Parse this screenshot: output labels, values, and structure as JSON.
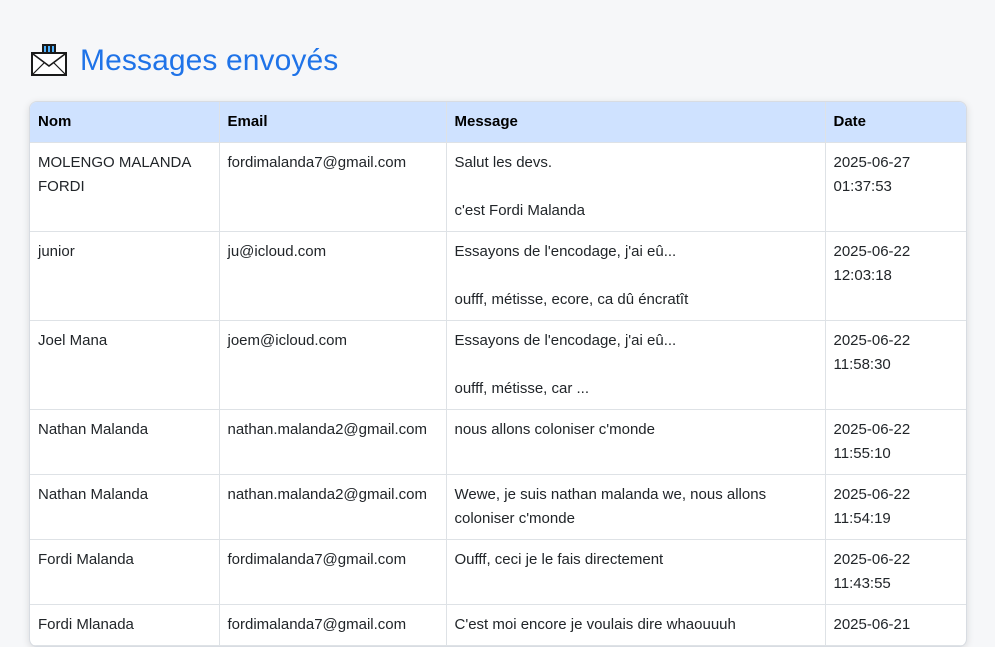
{
  "header": {
    "title": "Messages envoyés",
    "icon": "outbox-tray-icon"
  },
  "table": {
    "columns": [
      "Nom",
      "Email",
      "Message",
      "Date"
    ],
    "rows": [
      {
        "nom": "MOLENGO MALANDA FORDI",
        "email": "fordimalanda7@gmail.com",
        "message": [
          "Salut les devs.",
          "",
          "c'est Fordi Malanda"
        ],
        "date": "2025-06-27 01:37:53"
      },
      {
        "nom": "junior",
        "email": "ju@icloud.com",
        "message": [
          "Essayons de l'encodage, j'ai eû...",
          "",
          "oufff, métisse, ecore, ca dû éncratît"
        ],
        "date": "2025-06-22 12:03:18"
      },
      {
        "nom": "Joel Mana",
        "email": "joem@icloud.com",
        "message": [
          "Essayons de l'encodage, j'ai eû...",
          "",
          "oufff, métisse, car ..."
        ],
        "date": "2025-06-22 11:58:30"
      },
      {
        "nom": "Nathan Malanda",
        "email": "nathan.malanda2@gmail.com",
        "message": [
          "nous allons coloniser c'monde"
        ],
        "date": "2025-06-22 11:55:10"
      },
      {
        "nom": "Nathan Malanda",
        "email": "nathan.malanda2@gmail.com",
        "message": [
          "Wewe, je suis nathan malanda we, nous allons coloniser c'monde"
        ],
        "date": "2025-06-22 11:54:19"
      },
      {
        "nom": "Fordi Malanda",
        "email": "fordimalanda7@gmail.com",
        "message": [
          "Oufff, ceci je le fais directement"
        ],
        "date": "2025-06-22 11:43:55"
      },
      {
        "nom": "Fordi Mlanada",
        "email": "fordimalanda7@gmail.com",
        "message": [
          "C'est moi encore je voulais dire whaouuuh"
        ],
        "date": "2025-06-21"
      }
    ]
  },
  "colors": {
    "title": "#1f73e8",
    "header_bg": "#cfe2ff",
    "page_bg": "#f6f7f9"
  }
}
